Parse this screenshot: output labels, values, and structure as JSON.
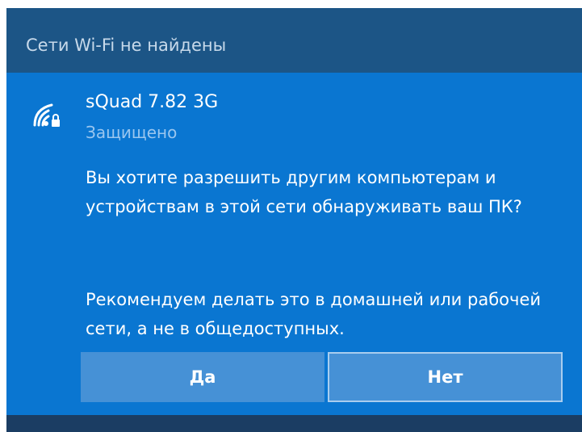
{
  "header": {
    "title": "Сети Wi-Fi не найдены"
  },
  "network": {
    "icon": "wifi-secured-icon",
    "name": "sQuad 7.82 3G",
    "status": "Защищено"
  },
  "prompt": {
    "question": "Вы хотите разрешить другим компьютерам и устройствам в этой сети обнаруживать ваш ПК?",
    "recommendation": "Рекомендуем делать это в домашней или рабочей сети, а не в общедоступных."
  },
  "buttons": {
    "yes_label": "Да",
    "no_label": "Нет"
  },
  "colors": {
    "panel": "#0a76d1",
    "header": "#1c5586",
    "button": "#4691d6"
  }
}
